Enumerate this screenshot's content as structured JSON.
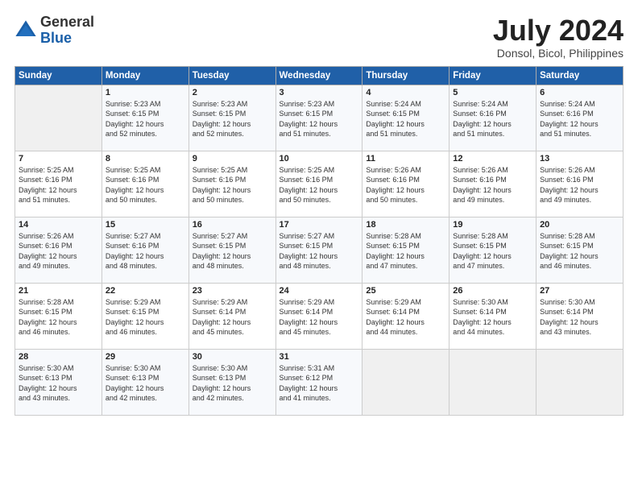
{
  "logo": {
    "general": "General",
    "blue": "Blue"
  },
  "title": "July 2024",
  "location": "Donsol, Bicol, Philippines",
  "headers": [
    "Sunday",
    "Monday",
    "Tuesday",
    "Wednesday",
    "Thursday",
    "Friday",
    "Saturday"
  ],
  "weeks": [
    [
      {
        "day": "",
        "info": ""
      },
      {
        "day": "1",
        "info": "Sunrise: 5:23 AM\nSunset: 6:15 PM\nDaylight: 12 hours\nand 52 minutes."
      },
      {
        "day": "2",
        "info": "Sunrise: 5:23 AM\nSunset: 6:15 PM\nDaylight: 12 hours\nand 52 minutes."
      },
      {
        "day": "3",
        "info": "Sunrise: 5:23 AM\nSunset: 6:15 PM\nDaylight: 12 hours\nand 51 minutes."
      },
      {
        "day": "4",
        "info": "Sunrise: 5:24 AM\nSunset: 6:15 PM\nDaylight: 12 hours\nand 51 minutes."
      },
      {
        "day": "5",
        "info": "Sunrise: 5:24 AM\nSunset: 6:16 PM\nDaylight: 12 hours\nand 51 minutes."
      },
      {
        "day": "6",
        "info": "Sunrise: 5:24 AM\nSunset: 6:16 PM\nDaylight: 12 hours\nand 51 minutes."
      }
    ],
    [
      {
        "day": "7",
        "info": "Sunrise: 5:25 AM\nSunset: 6:16 PM\nDaylight: 12 hours\nand 51 minutes."
      },
      {
        "day": "8",
        "info": "Sunrise: 5:25 AM\nSunset: 6:16 PM\nDaylight: 12 hours\nand 50 minutes."
      },
      {
        "day": "9",
        "info": "Sunrise: 5:25 AM\nSunset: 6:16 PM\nDaylight: 12 hours\nand 50 minutes."
      },
      {
        "day": "10",
        "info": "Sunrise: 5:25 AM\nSunset: 6:16 PM\nDaylight: 12 hours\nand 50 minutes."
      },
      {
        "day": "11",
        "info": "Sunrise: 5:26 AM\nSunset: 6:16 PM\nDaylight: 12 hours\nand 50 minutes."
      },
      {
        "day": "12",
        "info": "Sunrise: 5:26 AM\nSunset: 6:16 PM\nDaylight: 12 hours\nand 49 minutes."
      },
      {
        "day": "13",
        "info": "Sunrise: 5:26 AM\nSunset: 6:16 PM\nDaylight: 12 hours\nand 49 minutes."
      }
    ],
    [
      {
        "day": "14",
        "info": "Sunrise: 5:26 AM\nSunset: 6:16 PM\nDaylight: 12 hours\nand 49 minutes."
      },
      {
        "day": "15",
        "info": "Sunrise: 5:27 AM\nSunset: 6:16 PM\nDaylight: 12 hours\nand 48 minutes."
      },
      {
        "day": "16",
        "info": "Sunrise: 5:27 AM\nSunset: 6:15 PM\nDaylight: 12 hours\nand 48 minutes."
      },
      {
        "day": "17",
        "info": "Sunrise: 5:27 AM\nSunset: 6:15 PM\nDaylight: 12 hours\nand 48 minutes."
      },
      {
        "day": "18",
        "info": "Sunrise: 5:28 AM\nSunset: 6:15 PM\nDaylight: 12 hours\nand 47 minutes."
      },
      {
        "day": "19",
        "info": "Sunrise: 5:28 AM\nSunset: 6:15 PM\nDaylight: 12 hours\nand 47 minutes."
      },
      {
        "day": "20",
        "info": "Sunrise: 5:28 AM\nSunset: 6:15 PM\nDaylight: 12 hours\nand 46 minutes."
      }
    ],
    [
      {
        "day": "21",
        "info": "Sunrise: 5:28 AM\nSunset: 6:15 PM\nDaylight: 12 hours\nand 46 minutes."
      },
      {
        "day": "22",
        "info": "Sunrise: 5:29 AM\nSunset: 6:15 PM\nDaylight: 12 hours\nand 46 minutes."
      },
      {
        "day": "23",
        "info": "Sunrise: 5:29 AM\nSunset: 6:14 PM\nDaylight: 12 hours\nand 45 minutes."
      },
      {
        "day": "24",
        "info": "Sunrise: 5:29 AM\nSunset: 6:14 PM\nDaylight: 12 hours\nand 45 minutes."
      },
      {
        "day": "25",
        "info": "Sunrise: 5:29 AM\nSunset: 6:14 PM\nDaylight: 12 hours\nand 44 minutes."
      },
      {
        "day": "26",
        "info": "Sunrise: 5:30 AM\nSunset: 6:14 PM\nDaylight: 12 hours\nand 44 minutes."
      },
      {
        "day": "27",
        "info": "Sunrise: 5:30 AM\nSunset: 6:14 PM\nDaylight: 12 hours\nand 43 minutes."
      }
    ],
    [
      {
        "day": "28",
        "info": "Sunrise: 5:30 AM\nSunset: 6:13 PM\nDaylight: 12 hours\nand 43 minutes."
      },
      {
        "day": "29",
        "info": "Sunrise: 5:30 AM\nSunset: 6:13 PM\nDaylight: 12 hours\nand 42 minutes."
      },
      {
        "day": "30",
        "info": "Sunrise: 5:30 AM\nSunset: 6:13 PM\nDaylight: 12 hours\nand 42 minutes."
      },
      {
        "day": "31",
        "info": "Sunrise: 5:31 AM\nSunset: 6:12 PM\nDaylight: 12 hours\nand 41 minutes."
      },
      {
        "day": "",
        "info": ""
      },
      {
        "day": "",
        "info": ""
      },
      {
        "day": "",
        "info": ""
      }
    ]
  ]
}
